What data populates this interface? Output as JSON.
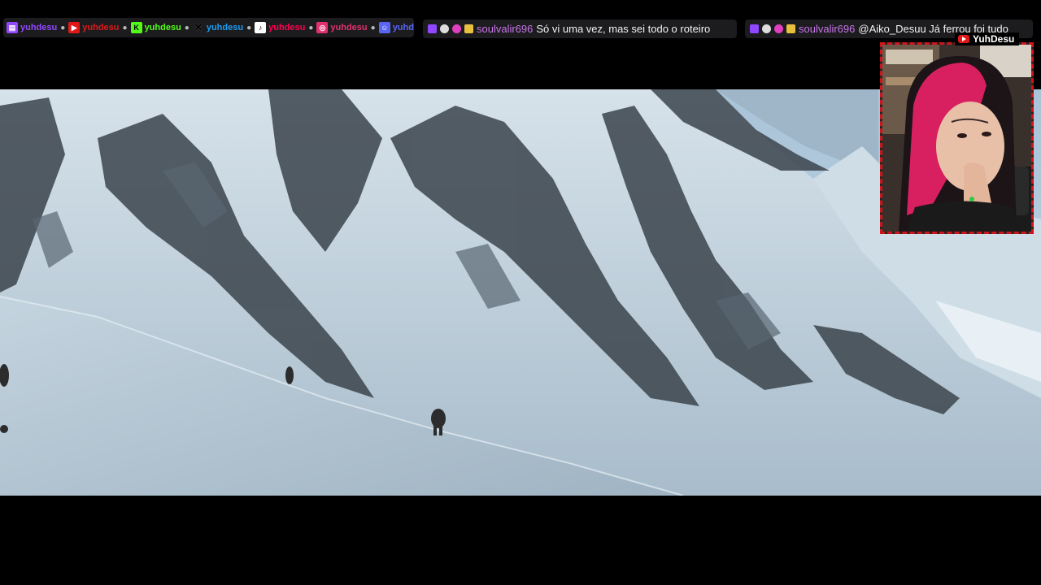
{
  "social": {
    "items": [
      {
        "icon": "twitch-icon",
        "handle": "yuhdesu",
        "color": "#9146ff"
      },
      {
        "icon": "youtube-icon",
        "handle": "yuhdesu",
        "color": "#e01818"
      },
      {
        "icon": "kick-icon",
        "handle": "yuhdesu",
        "color": "#53fc18"
      },
      {
        "icon": "x-icon",
        "handle": "yuhdesu",
        "color": "#1d9bf0"
      },
      {
        "icon": "tiktok-icon",
        "handle": "yuhdesu",
        "color": "#ff0050"
      },
      {
        "icon": "instagram-icon",
        "handle": "yuhdesu",
        "color": "#e1306c"
      },
      {
        "icon": "discord-icon",
        "handle": "yuhdesu",
        "color": "#5865f2"
      }
    ]
  },
  "chat": {
    "messages": [
      {
        "user": "soulvalir696",
        "text": "Só vi uma vez, mas sei todo o roteiro"
      },
      {
        "user": "soulvalir696",
        "text": "@Aiko_Desuu Já ferrou foi tudo"
      }
    ]
  },
  "webcam": {
    "channel_label": "YuhDesu"
  },
  "colors": {
    "username": "#c875e8",
    "webcam_border": "#d0141b"
  }
}
